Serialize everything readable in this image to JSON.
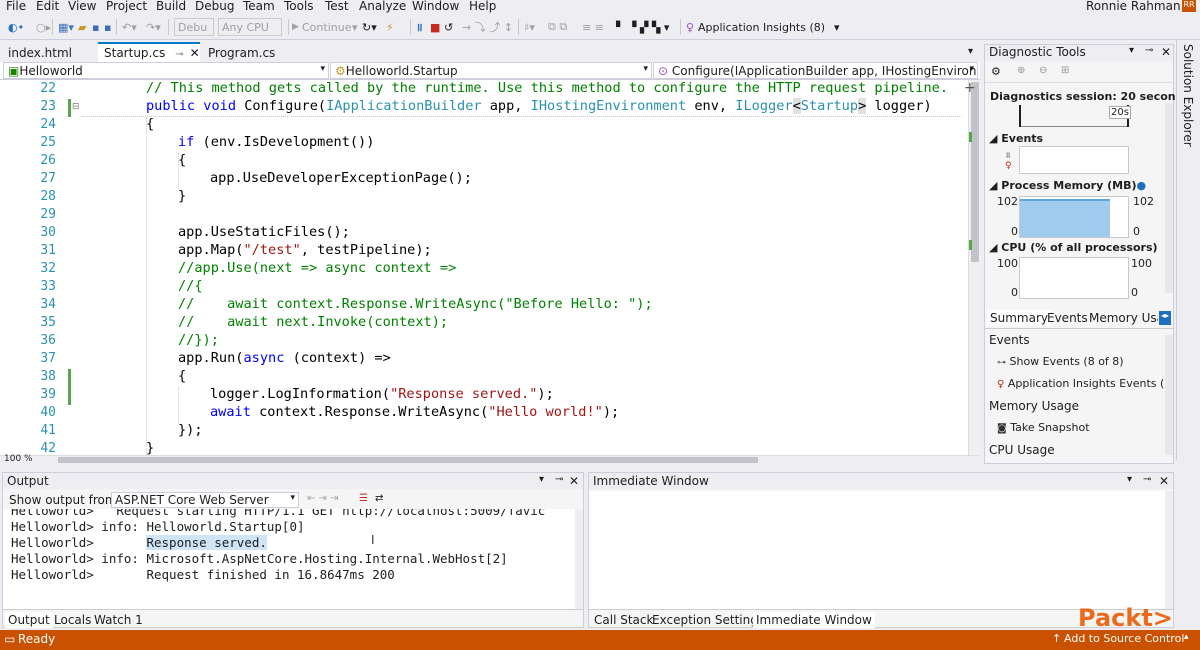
{
  "menu": [
    "File",
    "Edit",
    "View",
    "Project",
    "Build",
    "Debug",
    "Team",
    "Tools",
    "Test",
    "Analyze",
    "Window",
    "Help"
  ],
  "user": "Ronnie Rahman",
  "toolbar": {
    "config": "Debu",
    "platform": "Any CPU",
    "continue": "Continue",
    "insights": "Application Insights (8)"
  },
  "tabs": [
    "index.html",
    "Startup.cs",
    "Program.cs"
  ],
  "nav": {
    "project": "Helloworld",
    "class": "Helloworld.Startup",
    "method": "Configure(IApplicationBuilder app, IHostingEnvironment"
  },
  "code": {
    "lines": [
      "22",
      "23",
      "24",
      "25",
      "26",
      "27",
      "28",
      "29",
      "30",
      "31",
      "32",
      "33",
      "34",
      "35",
      "36",
      "37",
      "38",
      "39",
      "40",
      "41",
      "42"
    ],
    "l22": "// This method gets called by the runtime. Use this method to configure the HTTP request pipeline.",
    "l23a": "public void ",
    "l23b": "Configure(",
    "l23c": "IApplicationBuilder",
    "l23d": " app, ",
    "l23e": "IHostingEnvironment",
    "l23f": " env, ",
    "l23g": "ILogger",
    "l23h": "<",
    "l23i": "Startup",
    "l23j": ">",
    "l23k": " logger)",
    "l24": "{",
    "l25a": "if",
    "l25b": " (env.IsDevelopment())",
    "l26": "{",
    "l27": "app.UseDeveloperExceptionPage();",
    "l28": "}",
    "l30": "app.UseStaticFiles();",
    "l31a": "app.Map(",
    "l31b": "\"/test\"",
    "l31c": ", testPipeline);",
    "l32": "//app.Use(next => async context =>",
    "l33": "//{",
    "l34": "//    await context.Response.WriteAsync(\"Before Hello: \");",
    "l35": "//    await next.Invoke(context);",
    "l36": "//});",
    "l37a": "app.Run(",
    "l37b": "async",
    "l37c": " (context) =>",
    "l38": "{",
    "l39a": "logger.LogInformation(",
    "l39b": "\"Response served.\"",
    "l39c": ");",
    "l40a": "await",
    "l40b": " context.Response.WriteAsync(",
    "l40c": "\"Hello world!\"",
    "l40d": ");",
    "l41": "});",
    "l42": "}"
  },
  "zoom": "100 %",
  "diagnostic": {
    "title": "Diagnostic Tools",
    "session": "Diagnostics session: 20 secon...",
    "timeline": "20s",
    "events_label": "Events",
    "memory_label": "Process Memory (MB)",
    "memory_max": "102",
    "memory_min": "0",
    "cpu_label": "CPU (% of all processors)",
    "cpu_max": "100",
    "cpu_min": "0",
    "tabs": [
      "Summary",
      "Events",
      "Memory Usag"
    ],
    "events_header": "Events",
    "show_events": "Show Events (8 of 8)",
    "ai_events": "Application Insights Events (",
    "memory_header": "Memory Usage",
    "snapshot": "Take Snapshot",
    "cpu_header": "CPU Usage"
  },
  "solution_explorer": "Solution Explorer",
  "output": {
    "title": "Output",
    "show_from_label": "Show output from:",
    "source": "ASP.NET Core Web Server",
    "lines": [
      {
        "a": "Helloworld>",
        "b": "Request starting HTTP/1.1 GET http://localhost:5009/favic"
      },
      {
        "a": "Helloworld> info:",
        "b": "Helloworld.Startup[0]"
      },
      {
        "a": "Helloworld>",
        "b": "Response served."
      },
      {
        "a": "Helloworld> info:",
        "b": "Microsoft.AspNetCore.Hosting.Internal.WebHost[2]"
      },
      {
        "a": "Helloworld>",
        "b": "Request finished in 16.8647ms 200"
      }
    ],
    "tabs": [
      "Output",
      "Locals",
      "Watch 1"
    ]
  },
  "immediate": {
    "title": "Immediate Window",
    "tabs": [
      "Call Stack",
      "Exception Settings",
      "Immediate Window"
    ]
  },
  "status": {
    "ready": "Ready",
    "source_control": "Add to Source Control",
    "logo": "Packt>"
  }
}
